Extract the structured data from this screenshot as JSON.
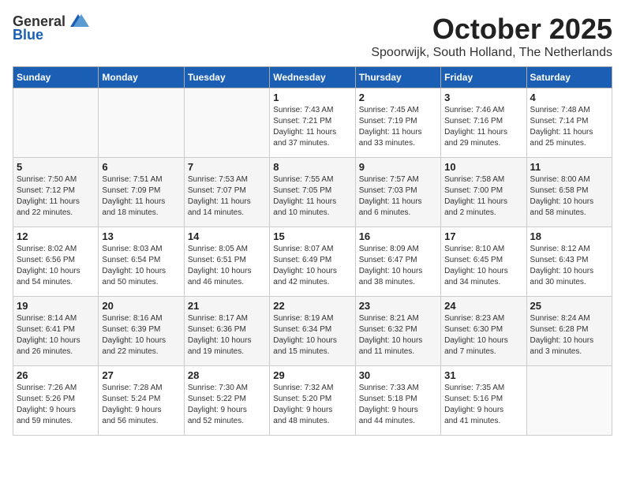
{
  "header": {
    "logo_general": "General",
    "logo_blue": "Blue",
    "month_title": "October 2025",
    "location": "Spoorwijk, South Holland, The Netherlands"
  },
  "weekdays": [
    "Sunday",
    "Monday",
    "Tuesday",
    "Wednesday",
    "Thursday",
    "Friday",
    "Saturday"
  ],
  "weeks": [
    [
      {
        "day": "",
        "info": ""
      },
      {
        "day": "",
        "info": ""
      },
      {
        "day": "",
        "info": ""
      },
      {
        "day": "1",
        "info": "Sunrise: 7:43 AM\nSunset: 7:21 PM\nDaylight: 11 hours\nand 37 minutes."
      },
      {
        "day": "2",
        "info": "Sunrise: 7:45 AM\nSunset: 7:19 PM\nDaylight: 11 hours\nand 33 minutes."
      },
      {
        "day": "3",
        "info": "Sunrise: 7:46 AM\nSunset: 7:16 PM\nDaylight: 11 hours\nand 29 minutes."
      },
      {
        "day": "4",
        "info": "Sunrise: 7:48 AM\nSunset: 7:14 PM\nDaylight: 11 hours\nand 25 minutes."
      }
    ],
    [
      {
        "day": "5",
        "info": "Sunrise: 7:50 AM\nSunset: 7:12 PM\nDaylight: 11 hours\nand 22 minutes."
      },
      {
        "day": "6",
        "info": "Sunrise: 7:51 AM\nSunset: 7:09 PM\nDaylight: 11 hours\nand 18 minutes."
      },
      {
        "day": "7",
        "info": "Sunrise: 7:53 AM\nSunset: 7:07 PM\nDaylight: 11 hours\nand 14 minutes."
      },
      {
        "day": "8",
        "info": "Sunrise: 7:55 AM\nSunset: 7:05 PM\nDaylight: 11 hours\nand 10 minutes."
      },
      {
        "day": "9",
        "info": "Sunrise: 7:57 AM\nSunset: 7:03 PM\nDaylight: 11 hours\nand 6 minutes."
      },
      {
        "day": "10",
        "info": "Sunrise: 7:58 AM\nSunset: 7:00 PM\nDaylight: 11 hours\nand 2 minutes."
      },
      {
        "day": "11",
        "info": "Sunrise: 8:00 AM\nSunset: 6:58 PM\nDaylight: 10 hours\nand 58 minutes."
      }
    ],
    [
      {
        "day": "12",
        "info": "Sunrise: 8:02 AM\nSunset: 6:56 PM\nDaylight: 10 hours\nand 54 minutes."
      },
      {
        "day": "13",
        "info": "Sunrise: 8:03 AM\nSunset: 6:54 PM\nDaylight: 10 hours\nand 50 minutes."
      },
      {
        "day": "14",
        "info": "Sunrise: 8:05 AM\nSunset: 6:51 PM\nDaylight: 10 hours\nand 46 minutes."
      },
      {
        "day": "15",
        "info": "Sunrise: 8:07 AM\nSunset: 6:49 PM\nDaylight: 10 hours\nand 42 minutes."
      },
      {
        "day": "16",
        "info": "Sunrise: 8:09 AM\nSunset: 6:47 PM\nDaylight: 10 hours\nand 38 minutes."
      },
      {
        "day": "17",
        "info": "Sunrise: 8:10 AM\nSunset: 6:45 PM\nDaylight: 10 hours\nand 34 minutes."
      },
      {
        "day": "18",
        "info": "Sunrise: 8:12 AM\nSunset: 6:43 PM\nDaylight: 10 hours\nand 30 minutes."
      }
    ],
    [
      {
        "day": "19",
        "info": "Sunrise: 8:14 AM\nSunset: 6:41 PM\nDaylight: 10 hours\nand 26 minutes."
      },
      {
        "day": "20",
        "info": "Sunrise: 8:16 AM\nSunset: 6:39 PM\nDaylight: 10 hours\nand 22 minutes."
      },
      {
        "day": "21",
        "info": "Sunrise: 8:17 AM\nSunset: 6:36 PM\nDaylight: 10 hours\nand 19 minutes."
      },
      {
        "day": "22",
        "info": "Sunrise: 8:19 AM\nSunset: 6:34 PM\nDaylight: 10 hours\nand 15 minutes."
      },
      {
        "day": "23",
        "info": "Sunrise: 8:21 AM\nSunset: 6:32 PM\nDaylight: 10 hours\nand 11 minutes."
      },
      {
        "day": "24",
        "info": "Sunrise: 8:23 AM\nSunset: 6:30 PM\nDaylight: 10 hours\nand 7 minutes."
      },
      {
        "day": "25",
        "info": "Sunrise: 8:24 AM\nSunset: 6:28 PM\nDaylight: 10 hours\nand 3 minutes."
      }
    ],
    [
      {
        "day": "26",
        "info": "Sunrise: 7:26 AM\nSunset: 5:26 PM\nDaylight: 9 hours\nand 59 minutes."
      },
      {
        "day": "27",
        "info": "Sunrise: 7:28 AM\nSunset: 5:24 PM\nDaylight: 9 hours\nand 56 minutes."
      },
      {
        "day": "28",
        "info": "Sunrise: 7:30 AM\nSunset: 5:22 PM\nDaylight: 9 hours\nand 52 minutes."
      },
      {
        "day": "29",
        "info": "Sunrise: 7:32 AM\nSunset: 5:20 PM\nDaylight: 9 hours\nand 48 minutes."
      },
      {
        "day": "30",
        "info": "Sunrise: 7:33 AM\nSunset: 5:18 PM\nDaylight: 9 hours\nand 44 minutes."
      },
      {
        "day": "31",
        "info": "Sunrise: 7:35 AM\nSunset: 5:16 PM\nDaylight: 9 hours\nand 41 minutes."
      },
      {
        "day": "",
        "info": ""
      }
    ]
  ]
}
